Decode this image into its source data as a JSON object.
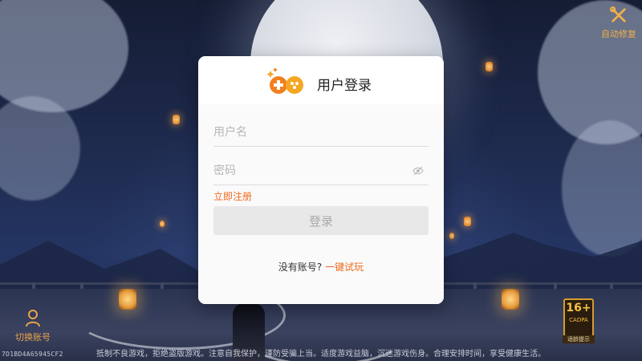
{
  "corner": {
    "repair_label": "自动修复",
    "switch_account_label": "切换账号",
    "device_id": "7D1BD4A65945CF2",
    "notice": "抵制不良游戏，拒绝盗版游戏。注意自我保护，谨防受骗上当。适度游戏益脑，沉迷游戏伤身。合理安排时间，享受健康生活。"
  },
  "age_badge": {
    "rating": "16+",
    "sub": "CADPA",
    "caption": "适龄提示"
  },
  "dialog": {
    "title": "用户登录",
    "username_placeholder": "用户名",
    "password_placeholder": "密码",
    "register_link": "立即注册",
    "login_button": "登录",
    "no_account_text": "没有账号?",
    "quick_play_link": "一键试玩"
  },
  "colors": {
    "accent": "#f06a1d",
    "button_bg": "#e8e8e8",
    "button_text": "#a9a9a9",
    "badge_gold": "#f4c040"
  },
  "icons": [
    "repair-tools-icon",
    "switch-account-icon",
    "game-controller-logo-icon",
    "eye-hidden-icon"
  ]
}
